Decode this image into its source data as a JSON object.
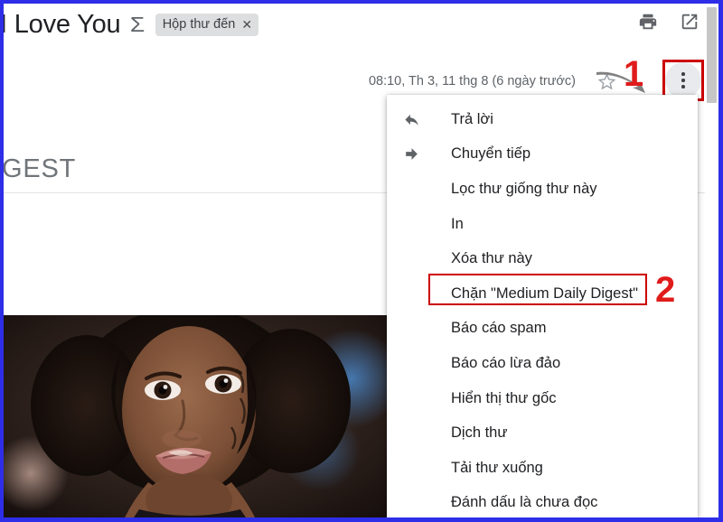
{
  "frame": {
    "border_color": "#2e2ee8"
  },
  "email": {
    "subject": "I Love You",
    "thread_icon": "thread-sigma-icon",
    "label_chip": {
      "text": "Hộp thư đến",
      "close_glyph": "✕"
    },
    "date": "08:10, Th 3, 11 thg 8 (6 ngày trước)",
    "body_fragment": "GEST",
    "header_actions": [
      {
        "name": "print-icon",
        "label": "In"
      },
      {
        "name": "open-in-new-window-icon",
        "label": "Mở trong cửa sổ mới"
      }
    ],
    "star_icon": "star-outline-icon",
    "more_button_icon": "more-vertical-icon"
  },
  "menu": {
    "items": [
      {
        "label": "Trả lời",
        "icon": "reply-icon"
      },
      {
        "label": "Chuyển tiếp",
        "icon": "forward-icon"
      },
      {
        "label": "Lọc thư giống thư này",
        "icon": ""
      },
      {
        "label": "In",
        "icon": ""
      },
      {
        "label": "Xóa thư này",
        "icon": ""
      },
      {
        "label": "Chặn \"Medium Daily Digest\"",
        "icon": ""
      },
      {
        "label": "Báo cáo spam",
        "icon": ""
      },
      {
        "label": "Báo cáo lừa đảo",
        "icon": ""
      },
      {
        "label": "Hiển thị thư gốc",
        "icon": ""
      },
      {
        "label": "Dịch thư",
        "icon": ""
      },
      {
        "label": "Tải thư xuống",
        "icon": ""
      },
      {
        "label": "Đánh dấu là chưa đọc",
        "icon": ""
      }
    ]
  },
  "annotations": {
    "color": "#e01b1b",
    "step_1": "1",
    "step_2": "2"
  }
}
